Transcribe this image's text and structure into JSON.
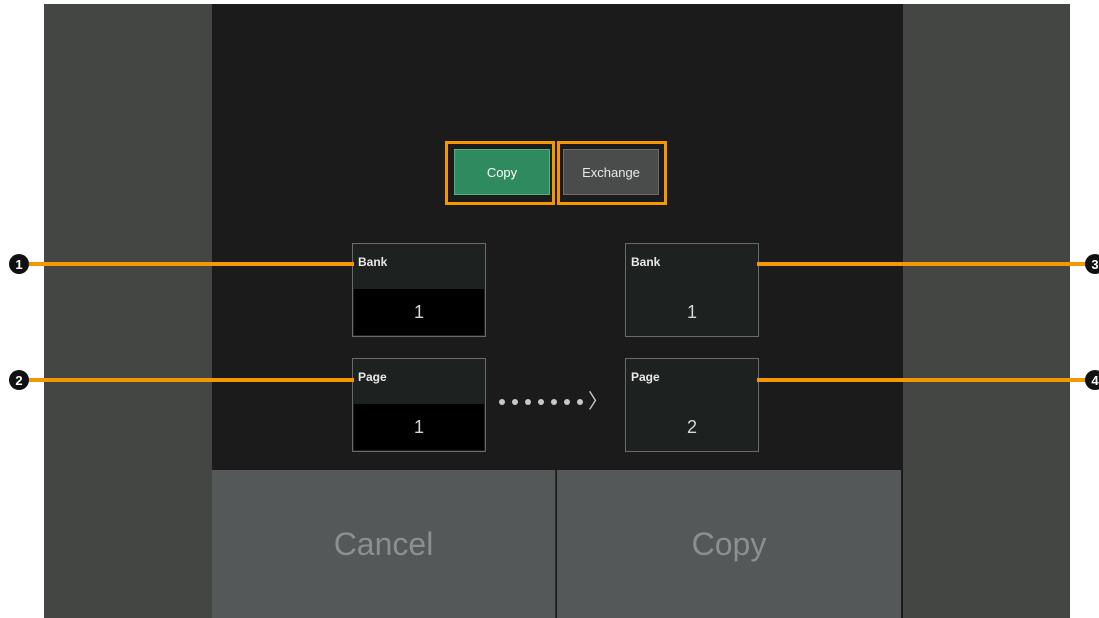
{
  "mode": {
    "copy_label": "Copy",
    "exchange_label": "Exchange",
    "selected": "Copy"
  },
  "source": {
    "bank_label": "Bank",
    "bank_value": "1",
    "page_label": "Page",
    "page_value": "1"
  },
  "destination": {
    "bank_label": "Bank",
    "bank_value": "1",
    "page_label": "Page",
    "page_value": "2"
  },
  "callouts": [
    "1",
    "2",
    "3",
    "4"
  ],
  "buttons": {
    "cancel_label": "Cancel",
    "copy_label": "Copy"
  },
  "colors": {
    "accent": "#f39800",
    "selected_mode": "#2f8a5f"
  }
}
